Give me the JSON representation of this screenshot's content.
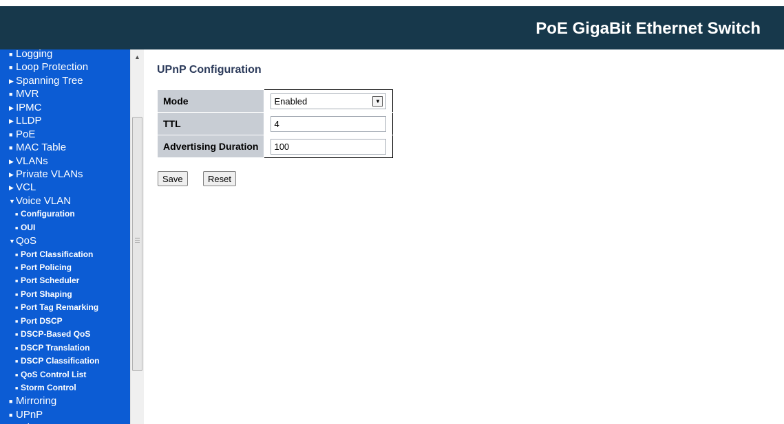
{
  "header": {
    "title": "PoE GigaBit Ethernet Switch"
  },
  "sidebar": {
    "items": [
      {
        "label": "Logging",
        "level": "top",
        "marker": "bullet"
      },
      {
        "label": "Loop Protection",
        "level": "top",
        "marker": "bullet"
      },
      {
        "label": "Spanning Tree",
        "level": "top",
        "marker": "collapsed"
      },
      {
        "label": "MVR",
        "level": "top",
        "marker": "bullet"
      },
      {
        "label": "IPMC",
        "level": "top",
        "marker": "collapsed"
      },
      {
        "label": "LLDP",
        "level": "top",
        "marker": "collapsed"
      },
      {
        "label": "PoE",
        "level": "top",
        "marker": "bullet"
      },
      {
        "label": "MAC Table",
        "level": "top",
        "marker": "bullet"
      },
      {
        "label": "VLANs",
        "level": "top",
        "marker": "collapsed"
      },
      {
        "label": "Private VLANs",
        "level": "top",
        "marker": "collapsed"
      },
      {
        "label": "VCL",
        "level": "top",
        "marker": "collapsed"
      },
      {
        "label": "Voice VLAN",
        "level": "top",
        "marker": "expanded"
      },
      {
        "label": "Configuration",
        "level": "sub",
        "marker": "bullet"
      },
      {
        "label": "OUI",
        "level": "sub",
        "marker": "bullet"
      },
      {
        "label": "QoS",
        "level": "top",
        "marker": "expanded"
      },
      {
        "label": "Port Classification",
        "level": "sub",
        "marker": "bullet"
      },
      {
        "label": "Port Policing",
        "level": "sub",
        "marker": "bullet"
      },
      {
        "label": "Port Scheduler",
        "level": "sub",
        "marker": "bullet"
      },
      {
        "label": "Port Shaping",
        "level": "sub",
        "marker": "bullet"
      },
      {
        "label": "Port Tag Remarking",
        "level": "sub",
        "marker": "bullet"
      },
      {
        "label": "Port DSCP",
        "level": "sub",
        "marker": "bullet"
      },
      {
        "label": "DSCP-Based QoS",
        "level": "sub",
        "marker": "bullet"
      },
      {
        "label": "DSCP Translation",
        "level": "sub",
        "marker": "bullet"
      },
      {
        "label": "DSCP Classification",
        "level": "sub",
        "marker": "bullet"
      },
      {
        "label": "QoS Control List",
        "level": "sub",
        "marker": "bullet"
      },
      {
        "label": "Storm Control",
        "level": "sub",
        "marker": "bullet"
      },
      {
        "label": "Mirroring",
        "level": "top",
        "marker": "bullet"
      },
      {
        "label": "UPnP",
        "level": "top",
        "marker": "bullet"
      },
      {
        "label": "sFlow",
        "level": "top",
        "marker": "bullet"
      }
    ]
  },
  "main": {
    "title": "UPnP Configuration",
    "rows": [
      {
        "label": "Mode",
        "type": "select",
        "value": "Enabled"
      },
      {
        "label": "TTL",
        "type": "input",
        "value": "4"
      },
      {
        "label": "Advertising Duration",
        "type": "input",
        "value": "100"
      }
    ],
    "buttons": {
      "save": "Save",
      "reset": "Reset"
    }
  },
  "colors": {
    "header_bg": "#17384b",
    "nav_bg": "#0c5cd4",
    "table_header_bg": "#c8cdd4"
  }
}
